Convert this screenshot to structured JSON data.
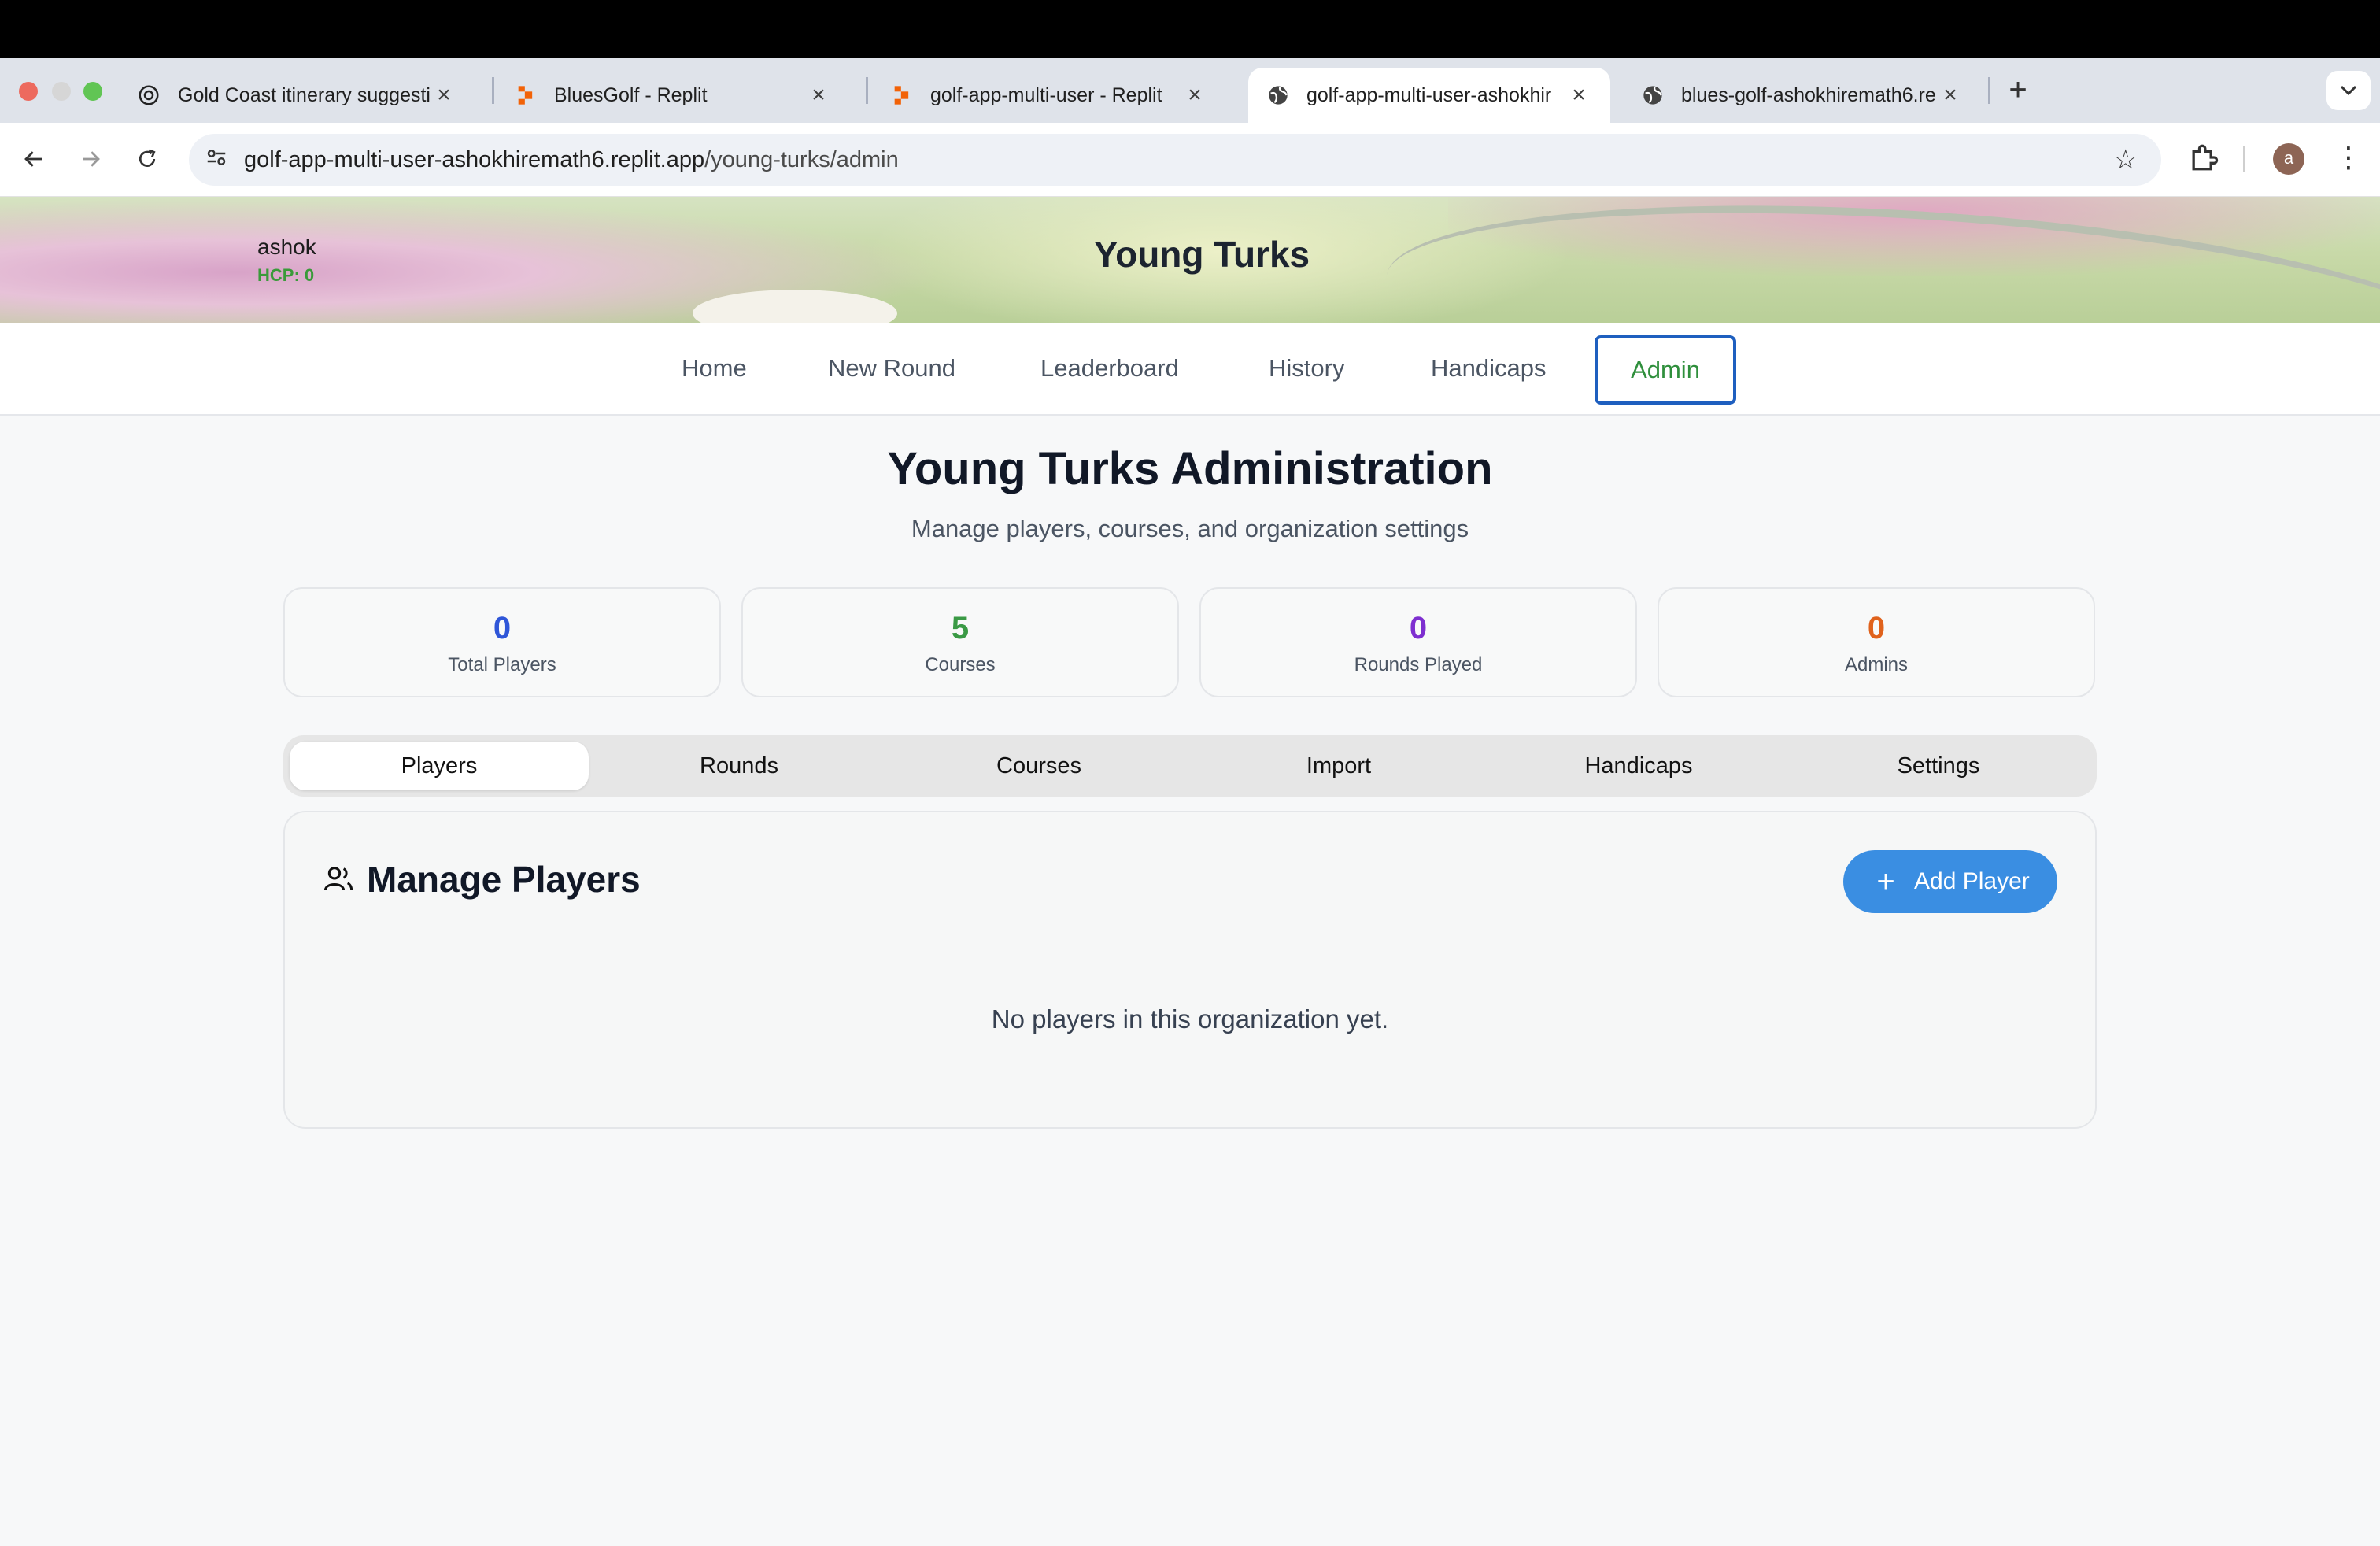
{
  "browser": {
    "tabs": [
      {
        "title": "Gold Coast itinerary suggestio",
        "icon": "chatgpt-icon"
      },
      {
        "title": "BluesGolf - Replit",
        "icon": "replit-icon"
      },
      {
        "title": "golf-app-multi-user - Replit",
        "icon": "replit-icon"
      },
      {
        "title": "golf-app-multi-user-ashokhir",
        "icon": "globe-icon",
        "active": true
      },
      {
        "title": "blues-golf-ashokhiremath6.re",
        "icon": "globe-icon"
      }
    ],
    "address": {
      "host": "golf-app-multi-user-ashokhiremath6.replit.app",
      "path": "/young-turks/admin"
    },
    "profile_initial": "a",
    "colors": {
      "close": "#ed6a5e",
      "minimize": "#d6d6d6",
      "maximize": "#61c554",
      "replit": "#f26207"
    }
  },
  "header": {
    "user_name": "ashok",
    "user_hcp": "HCP: 0",
    "title": "Young Turks"
  },
  "nav": {
    "items": [
      "Home",
      "New Round",
      "Leaderboard",
      "History",
      "Handicaps",
      "Admin"
    ],
    "active": "Admin"
  },
  "page": {
    "title": "Young Turks Administration",
    "subtitle": "Manage players, courses, and organization settings"
  },
  "stats": [
    {
      "value": "0",
      "label": "Total Players",
      "color": "#2f56d8"
    },
    {
      "value": "5",
      "label": "Courses",
      "color": "#3a9a45"
    },
    {
      "value": "0",
      "label": "Rounds Played",
      "color": "#7e2fd0"
    },
    {
      "value": "0",
      "label": "Admins",
      "color": "#e0621c"
    }
  ],
  "subtabs": {
    "items": [
      "Players",
      "Rounds",
      "Courses",
      "Import",
      "Handicaps",
      "Settings"
    ],
    "active": "Players"
  },
  "panel": {
    "title": "Manage Players",
    "add_button": "Add Player",
    "empty_message": "No players in this organization yet."
  }
}
